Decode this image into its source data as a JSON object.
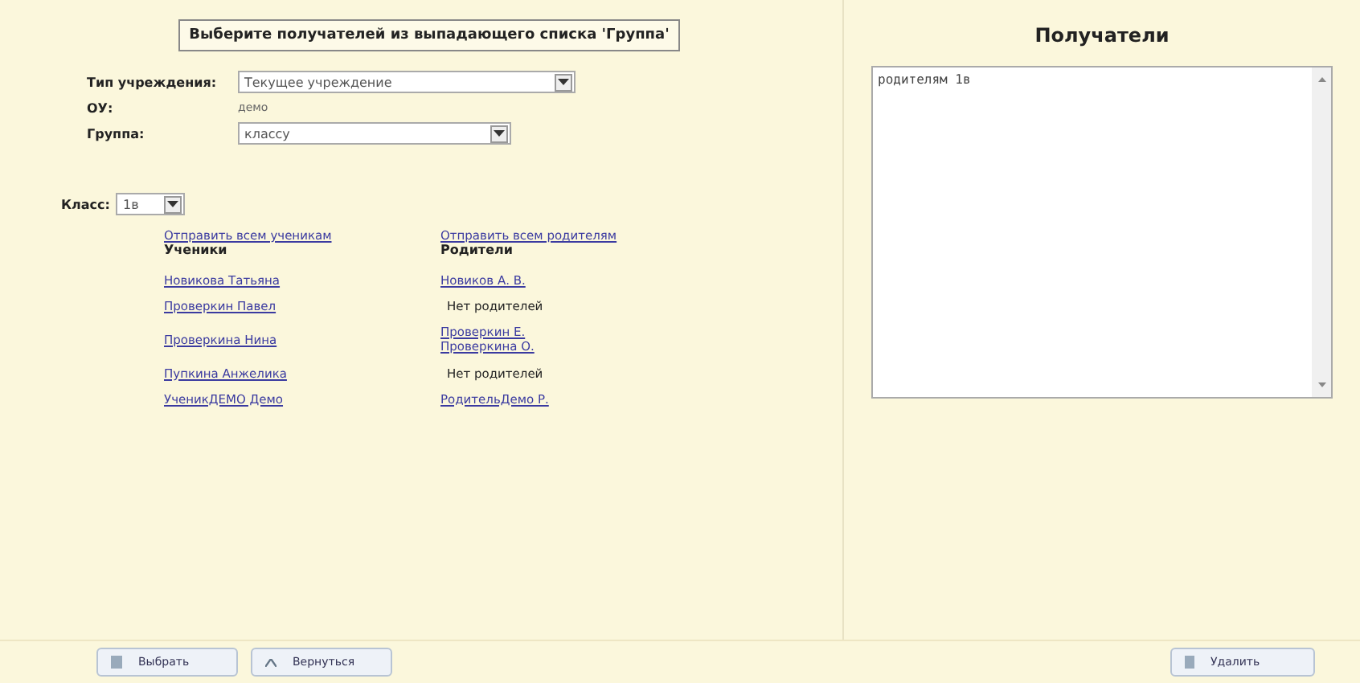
{
  "heading": "Выберите получателей из выпадающего списка 'Группа'",
  "form": [
    {
      "label": "Тип учреждения:",
      "kind": "select",
      "value": "Текущее учреждение"
    },
    {
      "label": "ОУ:",
      "kind": "text",
      "value": "демо"
    },
    {
      "label": "Группа:",
      "kind": "combo",
      "value": "классу"
    }
  ],
  "class_select": {
    "label": "Класс:",
    "value": "1в"
  },
  "students": {
    "send_all": "Отправить всем ученикам",
    "header": "Ученики",
    "items": [
      "Новикова Татьяна",
      "Проверкин Павел",
      "Проверкина Нина",
      "Пупкина Анжелика",
      "УченикДЕМО Демо"
    ]
  },
  "parents": {
    "send_all": "Отправить всем родителям",
    "header": "Родители",
    "items": [
      {
        "names": [
          "Новиков А. В."
        ]
      },
      {
        "none": "Нет родителей"
      },
      {
        "names": [
          "Проверкин Е.",
          "Проверкина О."
        ]
      },
      {
        "none": "Нет родителей"
      },
      {
        "names": [
          "РодительДемо Р."
        ]
      }
    ]
  },
  "recipients": {
    "title": "Получатели",
    "text": "родителям 1в"
  },
  "buttons": [
    {
      "label": "Выбрать",
      "kind": "select"
    },
    {
      "label": "Вернуться",
      "kind": "back"
    }
  ],
  "right_buttons": [
    {
      "label": "Удалить",
      "kind": "delete"
    }
  ]
}
